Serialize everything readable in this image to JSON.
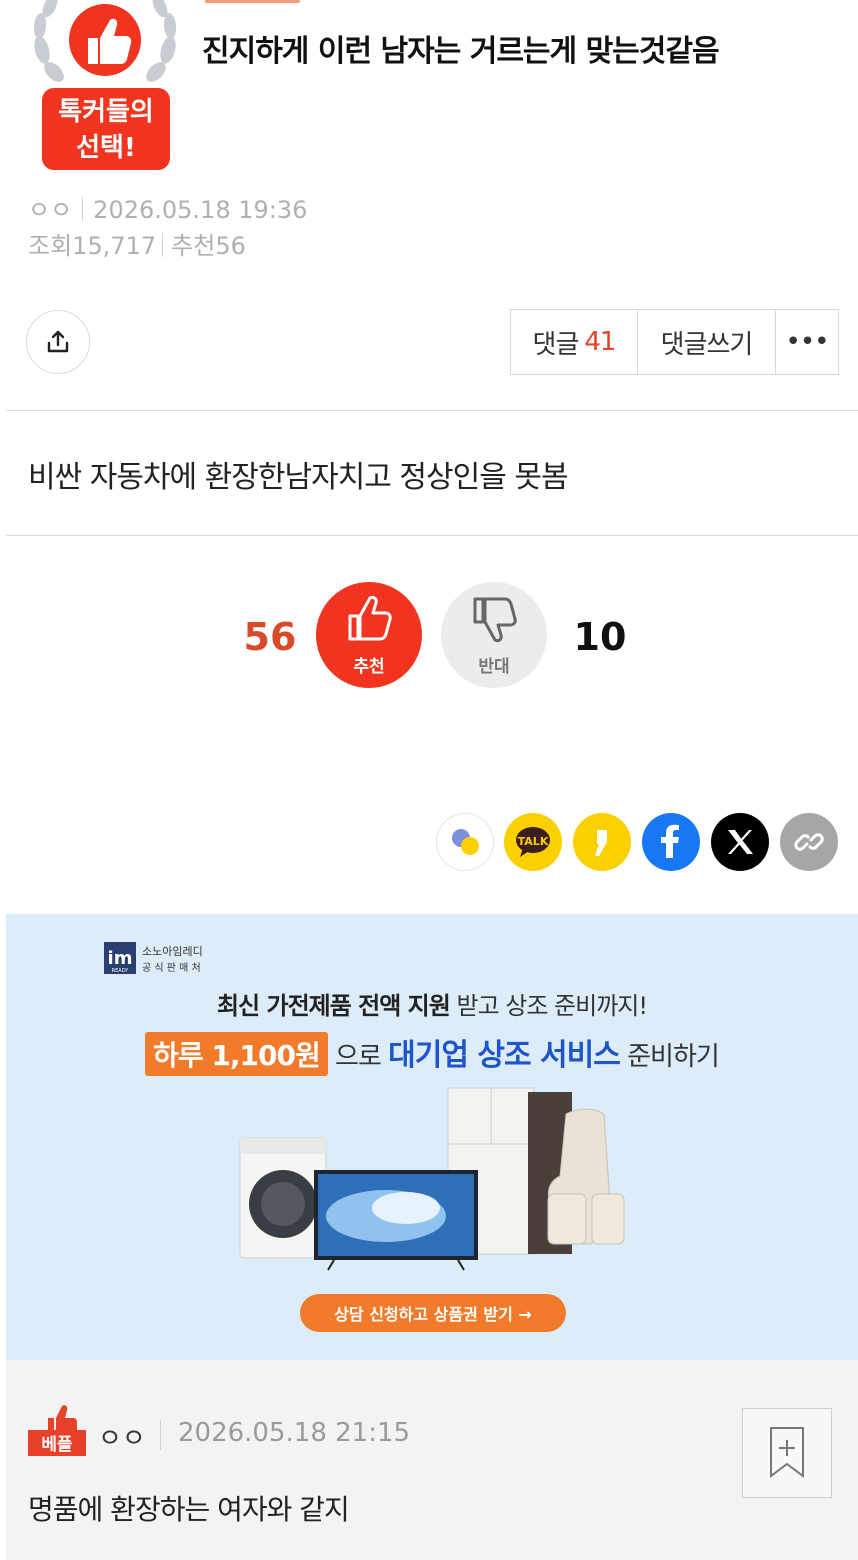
{
  "post": {
    "title": "진지하게 이런 남자는 거르는게 맞는것같음",
    "badge_line1": "톡커들의",
    "badge_line2": "선택!",
    "author": "ㅇㅇ",
    "date": "2026.05.18 19:36",
    "views_label": "조회",
    "views": "15,717",
    "recommend_label": "추천",
    "recommend": "56",
    "body": "비싼 자동차에 환장한남자치고 정상인을 못봄"
  },
  "actions": {
    "comments_label": "댓글",
    "comments_count": "41",
    "write_label": "댓글쓰기",
    "more_label": "•••"
  },
  "votes": {
    "up_count": "56",
    "up_label": "추천",
    "down_count": "10",
    "down_label": "반대"
  },
  "share": {
    "icons": [
      "kakaostory-icon",
      "kakaotalk-icon",
      "kakao-channel-icon",
      "facebook-icon",
      "x-icon",
      "link-icon"
    ],
    "talk_text": "TALK",
    "colors": {
      "kakao": "#fbd000",
      "facebook": "#1877f2",
      "x": "#000000",
      "link": "#a6a6a6"
    }
  },
  "ad": {
    "logo_top": "소노아임레디",
    "logo_bottom": "공 식 판 매 처",
    "logo_mark": "im",
    "logo_sub": "READY",
    "line1_bold": "최신 가전제품 전액 지원",
    "line1_rest": "받고 상조 준비까지!",
    "line2_pill": "하루 1,100원",
    "line2_mid": "으로",
    "line2_blue": "대기업 상조 서비스",
    "line2_end": "준비하기",
    "cta": "상담 신청하고 상품권 받기 →"
  },
  "comment": {
    "badge": "베플",
    "author": "ㅇㅇ",
    "date": "2026.05.18 21:15",
    "text": "명품에 환장하는 여자와 같지"
  },
  "colors": {
    "accent_red": "#f0341f",
    "count_red": "#d94a2b",
    "ad_bg": "#dcecf8",
    "ad_orange": "#f27b2b",
    "ad_blue": "#1f55c9"
  }
}
